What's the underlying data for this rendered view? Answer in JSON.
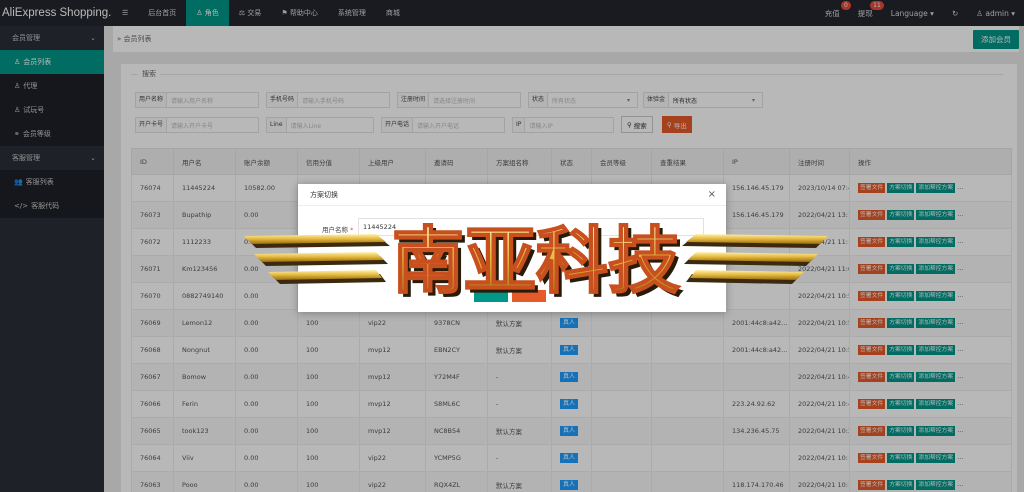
{
  "app_title": "AliExpress Shopping...",
  "topnav": [
    {
      "label": "☰",
      "icon": "menu-icon"
    },
    {
      "label": "后台首页"
    },
    {
      "label": "角色",
      "icon": "user-icon",
      "active": true
    },
    {
      "label": "交易",
      "icon": "scale-icon"
    },
    {
      "label": "帮助中心",
      "icon": "flag-icon"
    },
    {
      "label": "系统管理"
    },
    {
      "label": "商城"
    }
  ],
  "topright": {
    "recharge": "充值",
    "recharge_count": "0",
    "withdraw": "提现",
    "withdraw_count": "11",
    "language": "Language",
    "refresh_icon": "refresh-icon",
    "user": "admin"
  },
  "sidebar": {
    "groups": [
      {
        "label": "会员管理",
        "items": [
          {
            "label": "会员列表",
            "icon": "user-icon",
            "active": true
          },
          {
            "label": "代理",
            "icon": "user-icon"
          },
          {
            "label": "试玩号",
            "icon": "user-icon"
          },
          {
            "label": "会员等级",
            "icon": "link-icon"
          }
        ]
      },
      {
        "label": "客服管理",
        "items": [
          {
            "label": "客服列表",
            "icon": "users-icon"
          },
          {
            "label": "客服代码",
            "icon": "code-icon"
          }
        ]
      }
    ]
  },
  "breadcrumb": "会员列表",
  "add_member": "添加会员",
  "search": {
    "legend": "搜索",
    "row1": [
      {
        "label": "用户名称",
        "placeholder": "请输入用户名称"
      },
      {
        "label": "手机号码",
        "placeholder": "请输入手机号码"
      },
      {
        "label": "注册时间",
        "placeholder": "请选择注册时间"
      },
      {
        "label": "状态",
        "placeholder": "所有状态"
      },
      {
        "label": "体验金",
        "placeholder": "所有状态"
      }
    ],
    "row2": [
      {
        "label": "开户卡号",
        "placeholder": "请输入开户卡号"
      },
      {
        "label": "Line",
        "placeholder": "请输入Line"
      },
      {
        "label": "开户电话",
        "placeholder": "请输入开户电话"
      },
      {
        "label": "IP",
        "placeholder": "请输入IP"
      }
    ],
    "search_btn": "搜索",
    "export_btn": "导出"
  },
  "table": {
    "headers": [
      "ID",
      "用户名",
      "账户余额",
      "信用分值",
      "上级用户",
      "邀请码",
      "方案组名称",
      "状态",
      "会员等级",
      "查重结果",
      "IP",
      "注册时间",
      "操作"
    ],
    "actions": [
      "签署文件",
      "方案切换",
      "添加帮控方案",
      "..."
    ],
    "rows": [
      {
        "id": "76074",
        "user": "11445224",
        "bal": "10582.00",
        "credit": "",
        "parent": "",
        "code": "",
        "plan": "",
        "status": "",
        "level": "",
        "dup": "",
        "ip": "156.146.45.179",
        "time": "2023/10/14 07:45"
      },
      {
        "id": "76073",
        "user": "Bupathip",
        "bal": "0.00",
        "credit": "",
        "parent": "",
        "code": "",
        "plan": "",
        "status": "",
        "level": "",
        "dup": "",
        "ip": "156.146.45.179",
        "time": "2022/04/21 13:17"
      },
      {
        "id": "76072",
        "user": "1112233",
        "bal": "0.00",
        "credit": "",
        "parent": "",
        "code": "",
        "plan": "",
        "status": "",
        "level": "",
        "dup": "",
        "ip": "",
        "time": "2022/04/21 11:10"
      },
      {
        "id": "76071",
        "user": "Km123456",
        "bal": "0.00",
        "credit": "",
        "parent": "",
        "code": "",
        "plan": "",
        "status": "",
        "level": "",
        "dup": "",
        "ip": "",
        "time": "2022/04/21 11:01"
      },
      {
        "id": "76070",
        "user": "0882749140",
        "bal": "0.00",
        "credit": "",
        "parent": "",
        "code": "",
        "plan": "",
        "status": "",
        "level": "",
        "dup": "",
        "ip": "",
        "time": "2022/04/21 10:56"
      },
      {
        "id": "76069",
        "user": "Lemon12",
        "bal": "0.00",
        "credit": "100",
        "parent": "vip22",
        "code": "9378CN",
        "plan": "默认方案",
        "status": "真人",
        "level": "",
        "dup": "",
        "ip": "2001:44c8:a42...",
        "time": "2022/04/21 10:53"
      },
      {
        "id": "76068",
        "user": "Nongnut",
        "bal": "0.00",
        "credit": "100",
        "parent": "mvp12",
        "code": "EBN2CY",
        "plan": "默认方案",
        "status": "真人",
        "level": "",
        "dup": "",
        "ip": "2001:44c8:a42...",
        "time": "2022/04/21 10:51"
      },
      {
        "id": "76067",
        "user": "Bomow",
        "bal": "0.00",
        "credit": "100",
        "parent": "mvp12",
        "code": "Y72M4F",
        "plan": "-",
        "status": "真人",
        "level": "",
        "dup": "",
        "ip": "",
        "time": "2022/04/21 10:49"
      },
      {
        "id": "76066",
        "user": "Ferin",
        "bal": "0.00",
        "credit": "100",
        "parent": "mvp12",
        "code": "S8ML6C",
        "plan": "-",
        "status": "真人",
        "level": "",
        "dup": "",
        "ip": "223.24.92.62",
        "time": "2022/04/21 10:48"
      },
      {
        "id": "76065",
        "user": "took123",
        "bal": "0.00",
        "credit": "100",
        "parent": "mvp12",
        "code": "NC8B54",
        "plan": "默认方案",
        "status": "真人",
        "level": "",
        "dup": "",
        "ip": "134.236.45.75",
        "time": "2022/04/21 10:31"
      },
      {
        "id": "76064",
        "user": "Viiv",
        "bal": "0.00",
        "credit": "100",
        "parent": "vip22",
        "code": "YCMP5G",
        "plan": "-",
        "status": "真人",
        "level": "",
        "dup": "",
        "ip": "",
        "time": "2022/04/21 10:19"
      },
      {
        "id": "76063",
        "user": "Pooo",
        "bal": "0.00",
        "credit": "100",
        "parent": "vip22",
        "code": "RQX4ZL",
        "plan": "默认方案",
        "status": "真人",
        "level": "",
        "dup": "",
        "ip": "118.174.170.46",
        "time": "2022/04/21 10:10"
      }
    ]
  },
  "modal": {
    "title": "方案切换",
    "field_label": "用户名称",
    "field_value": "11445224"
  },
  "watermark": {
    "text": "南亚科技"
  },
  "colors": {
    "accent": "#009688",
    "danger": "#e65a2a",
    "info": "#1e9fff",
    "topbar": "#23262e",
    "sidebar": "#2a2e36"
  }
}
